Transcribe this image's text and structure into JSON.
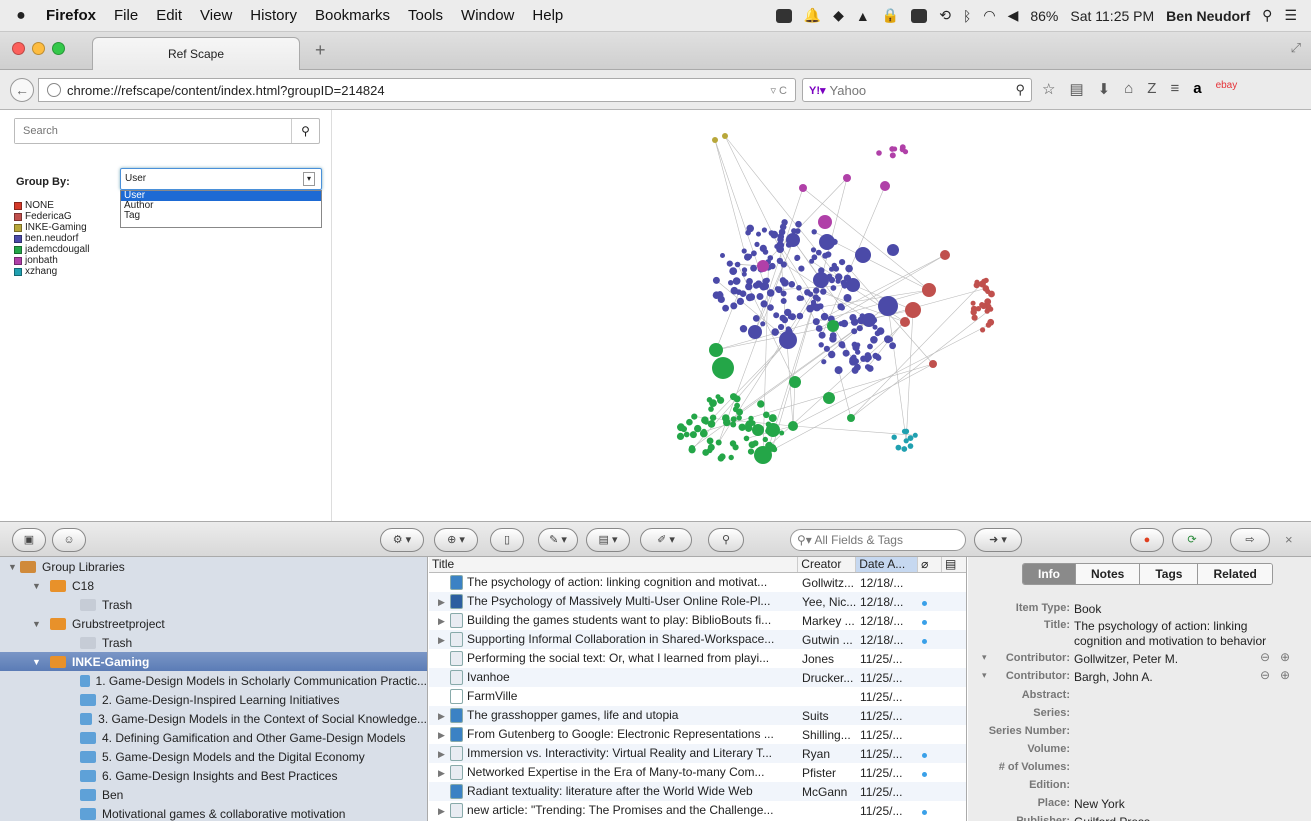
{
  "menubar": {
    "app": "Firefox",
    "items": [
      "File",
      "Edit",
      "View",
      "History",
      "Bookmarks",
      "Tools",
      "Window",
      "Help"
    ],
    "battery": "86%",
    "clock": "Sat 11:25 PM",
    "user": "Ben Neudorf"
  },
  "browser": {
    "tab_title": "Ref Scape",
    "url": "chrome://refscape/content/index.html?groupID=214824",
    "search_engine": "Yahoo"
  },
  "refscape": {
    "search_placeholder": "Search",
    "groupby_label": "Group By:",
    "groupby_selected": "User",
    "groupby_options": [
      "User",
      "Author",
      "Tag"
    ],
    "legend": [
      {
        "label": "NONE",
        "color": "#d43a2a"
      },
      {
        "label": "FedericaG",
        "color": "#c0504d"
      },
      {
        "label": "INKE-Gaming",
        "color": "#b8a73a"
      },
      {
        "label": "ben.neudorf",
        "color": "#4b4aa8"
      },
      {
        "label": "jademcdougall",
        "color": "#24a648"
      },
      {
        "label": "jonbath",
        "color": "#b040a8"
      },
      {
        "label": "xzhang",
        "color": "#20a0b0"
      }
    ]
  },
  "toolbar": {
    "search_placeholder": "All Fields & Tags"
  },
  "collections": [
    {
      "label": "Group Libraries",
      "level": 0,
      "expanded": true,
      "kind": "group"
    },
    {
      "label": "C18",
      "level": 1,
      "expanded": true,
      "kind": "folder"
    },
    {
      "label": "Trash",
      "level": 2,
      "kind": "trash"
    },
    {
      "label": "Grubstreetproject",
      "level": 1,
      "expanded": true,
      "kind": "folder"
    },
    {
      "label": "Trash",
      "level": 2,
      "kind": "trash"
    },
    {
      "label": "INKE-Gaming",
      "level": 1,
      "expanded": true,
      "kind": "folder",
      "selected": true
    },
    {
      "label": "1. Game-Design Models in Scholarly Communication Practic...",
      "level": 2,
      "kind": "sub"
    },
    {
      "label": "2. Game-Design-Inspired Learning Initiatives",
      "level": 2,
      "kind": "sub"
    },
    {
      "label": "3. Game-Design Models in the Context of Social Knowledge...",
      "level": 2,
      "kind": "sub"
    },
    {
      "label": "4. Defining Gamification and Other Game-Design Models",
      "level": 2,
      "kind": "sub"
    },
    {
      "label": "5. Game-Design Models and the Digital Economy",
      "level": 2,
      "kind": "sub"
    },
    {
      "label": "6. Game-Design Insights and Best Practices",
      "level": 2,
      "kind": "sub"
    },
    {
      "label": "Ben",
      "level": 2,
      "kind": "sub"
    },
    {
      "label": "Motivational games & collaborative motivation",
      "level": 2,
      "kind": "sub"
    }
  ],
  "items": {
    "columns": [
      "Title",
      "Creator",
      "Date A..."
    ],
    "rows": [
      {
        "title": "The psychology of action: linking cognition and motivat...",
        "creator": "Gollwitz...",
        "date": "12/18/...",
        "type": "book",
        "expand": false,
        "att": false
      },
      {
        "title": "The Psychology of Massively Multi-User Online  Role-Pl...",
        "creator": "Yee, Nic...",
        "date": "12/18/...",
        "type": "openbook",
        "expand": true,
        "att": true
      },
      {
        "title": "Building the games students want to play: BiblioBouts fi...",
        "creator": "Markey ...",
        "date": "12/18/...",
        "type": "doc",
        "expand": true,
        "att": true
      },
      {
        "title": "Supporting Informal Collaboration in Shared-Workspace...",
        "creator": "Gutwin ...",
        "date": "12/18/...",
        "type": "doc",
        "expand": true,
        "att": true
      },
      {
        "title": "Performing the social text: Or, what I learned from playi...",
        "creator": "Jones",
        "date": "11/25/...",
        "type": "doc",
        "expand": false,
        "att": false
      },
      {
        "title": "Ivanhoe",
        "creator": "Drucker...",
        "date": "11/25/...",
        "type": "doc",
        "expand": false,
        "att": false
      },
      {
        "title": "FarmVille",
        "creator": "",
        "date": "11/25/...",
        "type": "web",
        "expand": false,
        "att": false
      },
      {
        "title": "The grasshopper games, life and utopia",
        "creator": "Suits",
        "date": "11/25/...",
        "type": "book",
        "expand": true,
        "att": false
      },
      {
        "title": "From Gutenberg to Google: Electronic Representations ...",
        "creator": "Shilling...",
        "date": "11/25/...",
        "type": "book",
        "expand": true,
        "att": false
      },
      {
        "title": "Immersion vs. Interactivity: Virtual Reality and Literary T...",
        "creator": "Ryan",
        "date": "11/25/...",
        "type": "doc",
        "expand": true,
        "att": true
      },
      {
        "title": "Networked Expertise in the Era of Many-to-many Com...",
        "creator": "Pfister",
        "date": "11/25/...",
        "type": "doc",
        "expand": true,
        "att": true
      },
      {
        "title": "Radiant textuality: literature after the World Wide Web",
        "creator": "McGann",
        "date": "11/25/...",
        "type": "book",
        "expand": false,
        "att": false
      },
      {
        "title": "new article: \"Trending: The Promises and the Challenge...",
        "creator": "",
        "date": "11/25/...",
        "type": "doc",
        "expand": true,
        "att": true
      }
    ]
  },
  "itempane": {
    "tabs": [
      "Info",
      "Notes",
      "Tags",
      "Related"
    ],
    "active_tab": "Info",
    "fields": [
      {
        "label": "Item Type:",
        "value": "Book"
      },
      {
        "label": "Title:",
        "value": "The psychology of action: linking cognition and motivation to behavior"
      },
      {
        "label": "Contributor:",
        "value": "Gollwitzer, Peter M."
      },
      {
        "label": "Contributor:",
        "value": "Bargh, John A."
      },
      {
        "label": "Abstract:",
        "value": ""
      },
      {
        "label": "Series:",
        "value": ""
      },
      {
        "label": "Series Number:",
        "value": ""
      },
      {
        "label": "Volume:",
        "value": ""
      },
      {
        "label": "# of Volumes:",
        "value": ""
      },
      {
        "label": "Edition:",
        "value": ""
      },
      {
        "label": "Place:",
        "value": "New York"
      },
      {
        "label": "Publisher:",
        "value": "Guilford Press"
      }
    ]
  }
}
